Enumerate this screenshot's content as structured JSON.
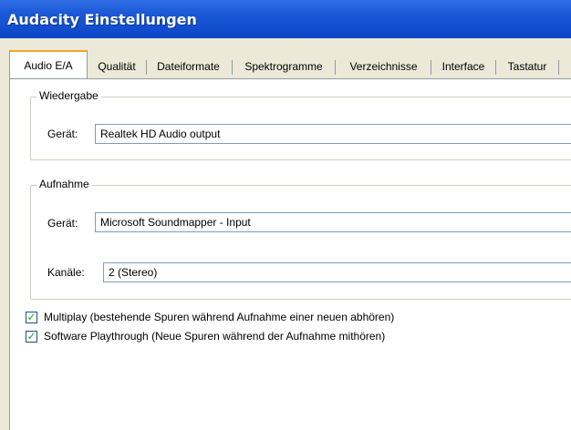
{
  "window": {
    "title": "Audacity Einstellungen"
  },
  "tabs": [
    {
      "label": "Audio E/A",
      "active": true
    },
    {
      "label": "Qualität"
    },
    {
      "label": "Dateiformate"
    },
    {
      "label": "Spektrogramme"
    },
    {
      "label": "Verzeichnisse"
    },
    {
      "label": "Interface"
    },
    {
      "label": "Tastatur"
    }
  ],
  "playback": {
    "legend": "Wiedergabe",
    "device_label": "Gerät:",
    "device_value": "Realtek HD Audio output"
  },
  "recording": {
    "legend": "Aufnahme",
    "device_label": "Gerät:",
    "device_value": "Microsoft Soundmapper - Input",
    "channels_label": "Kanäle:",
    "channels_value": "2 (Stereo)"
  },
  "options": [
    {
      "label": "Multiplay (bestehende Spuren während Aufnahme einer neuen abhören)",
      "checked": true
    },
    {
      "label": "Software Playthrough (Neue Spuren während der Aufnahme mithören)",
      "checked": true
    }
  ],
  "colors": {
    "titlebar": "#0b46c8",
    "tab_highlight": "#f5a623",
    "window_bg": "#ece9d8"
  }
}
